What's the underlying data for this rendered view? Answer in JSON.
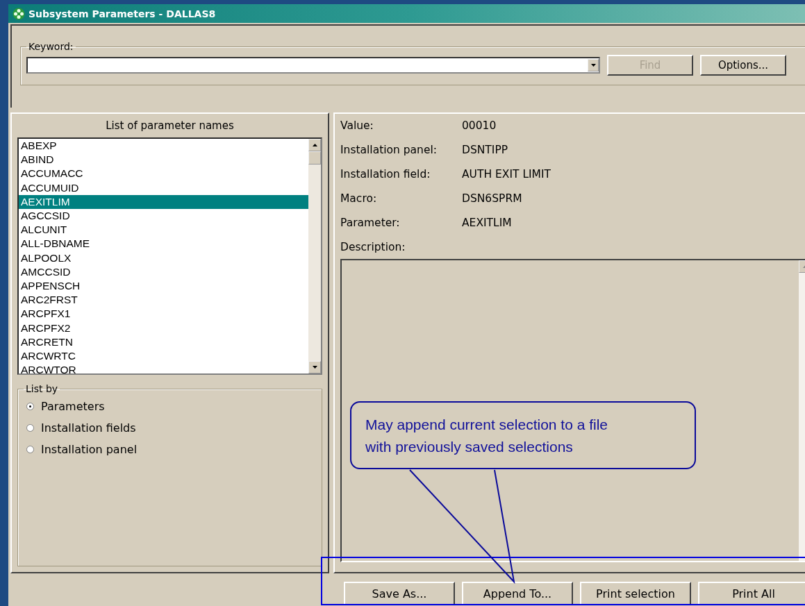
{
  "window": {
    "title": "Subsystem Parameters - DALLAS8"
  },
  "keyword": {
    "label": "Keyword:"
  },
  "find_button": {
    "label": "Find",
    "disabled": true
  },
  "options_button": {
    "label": "Options...",
    "disabled": false
  },
  "parameter_list": {
    "title": "List of parameter names",
    "items": [
      {
        "label": "ABEXP",
        "selected": false
      },
      {
        "label": "ABIND",
        "selected": false
      },
      {
        "label": "ACCUMACC",
        "selected": false
      },
      {
        "label": "ACCUMUID",
        "selected": false
      },
      {
        "label": "AEXITLIM",
        "selected": true
      },
      {
        "label": "AGCCSID",
        "selected": false
      },
      {
        "label": "ALCUNIT",
        "selected": false
      },
      {
        "label": "ALL-DBNAME",
        "selected": false
      },
      {
        "label": "ALPOOLX",
        "selected": false
      },
      {
        "label": "AMCCSID",
        "selected": false
      },
      {
        "label": "APPENSCH",
        "selected": false
      },
      {
        "label": "ARC2FRST",
        "selected": false
      },
      {
        "label": "ARCPFX1",
        "selected": false
      },
      {
        "label": "ARCPFX2",
        "selected": false
      },
      {
        "label": "ARCRETN",
        "selected": false
      },
      {
        "label": "ARCWRTC",
        "selected": false
      },
      {
        "label": "ARCWTOR",
        "selected": false
      }
    ]
  },
  "list_by": {
    "title": "List by",
    "options": [
      {
        "label": "Parameters",
        "selected": true
      },
      {
        "label": "Installation fields",
        "selected": false
      },
      {
        "label": "Installation panel",
        "selected": false
      }
    ]
  },
  "details": [
    {
      "label": "Value:",
      "value": "00010"
    },
    {
      "label": "Installation panel:",
      "value": "DSNTIPP"
    },
    {
      "label": "Installation field:",
      "value": "AUTH EXIT LIMIT"
    },
    {
      "label": "Macro:",
      "value": "DSN6SPRM"
    },
    {
      "label": "Parameter:",
      "value": "AEXITLIM"
    }
  ],
  "description": {
    "label": "Description:"
  },
  "buttons": [
    {
      "label": "Save As..."
    },
    {
      "label": "Append To..."
    },
    {
      "label": "Print selection"
    },
    {
      "label": "Print All"
    }
  ],
  "callout": {
    "text": "May append current selection to a file with previously saved selections"
  }
}
